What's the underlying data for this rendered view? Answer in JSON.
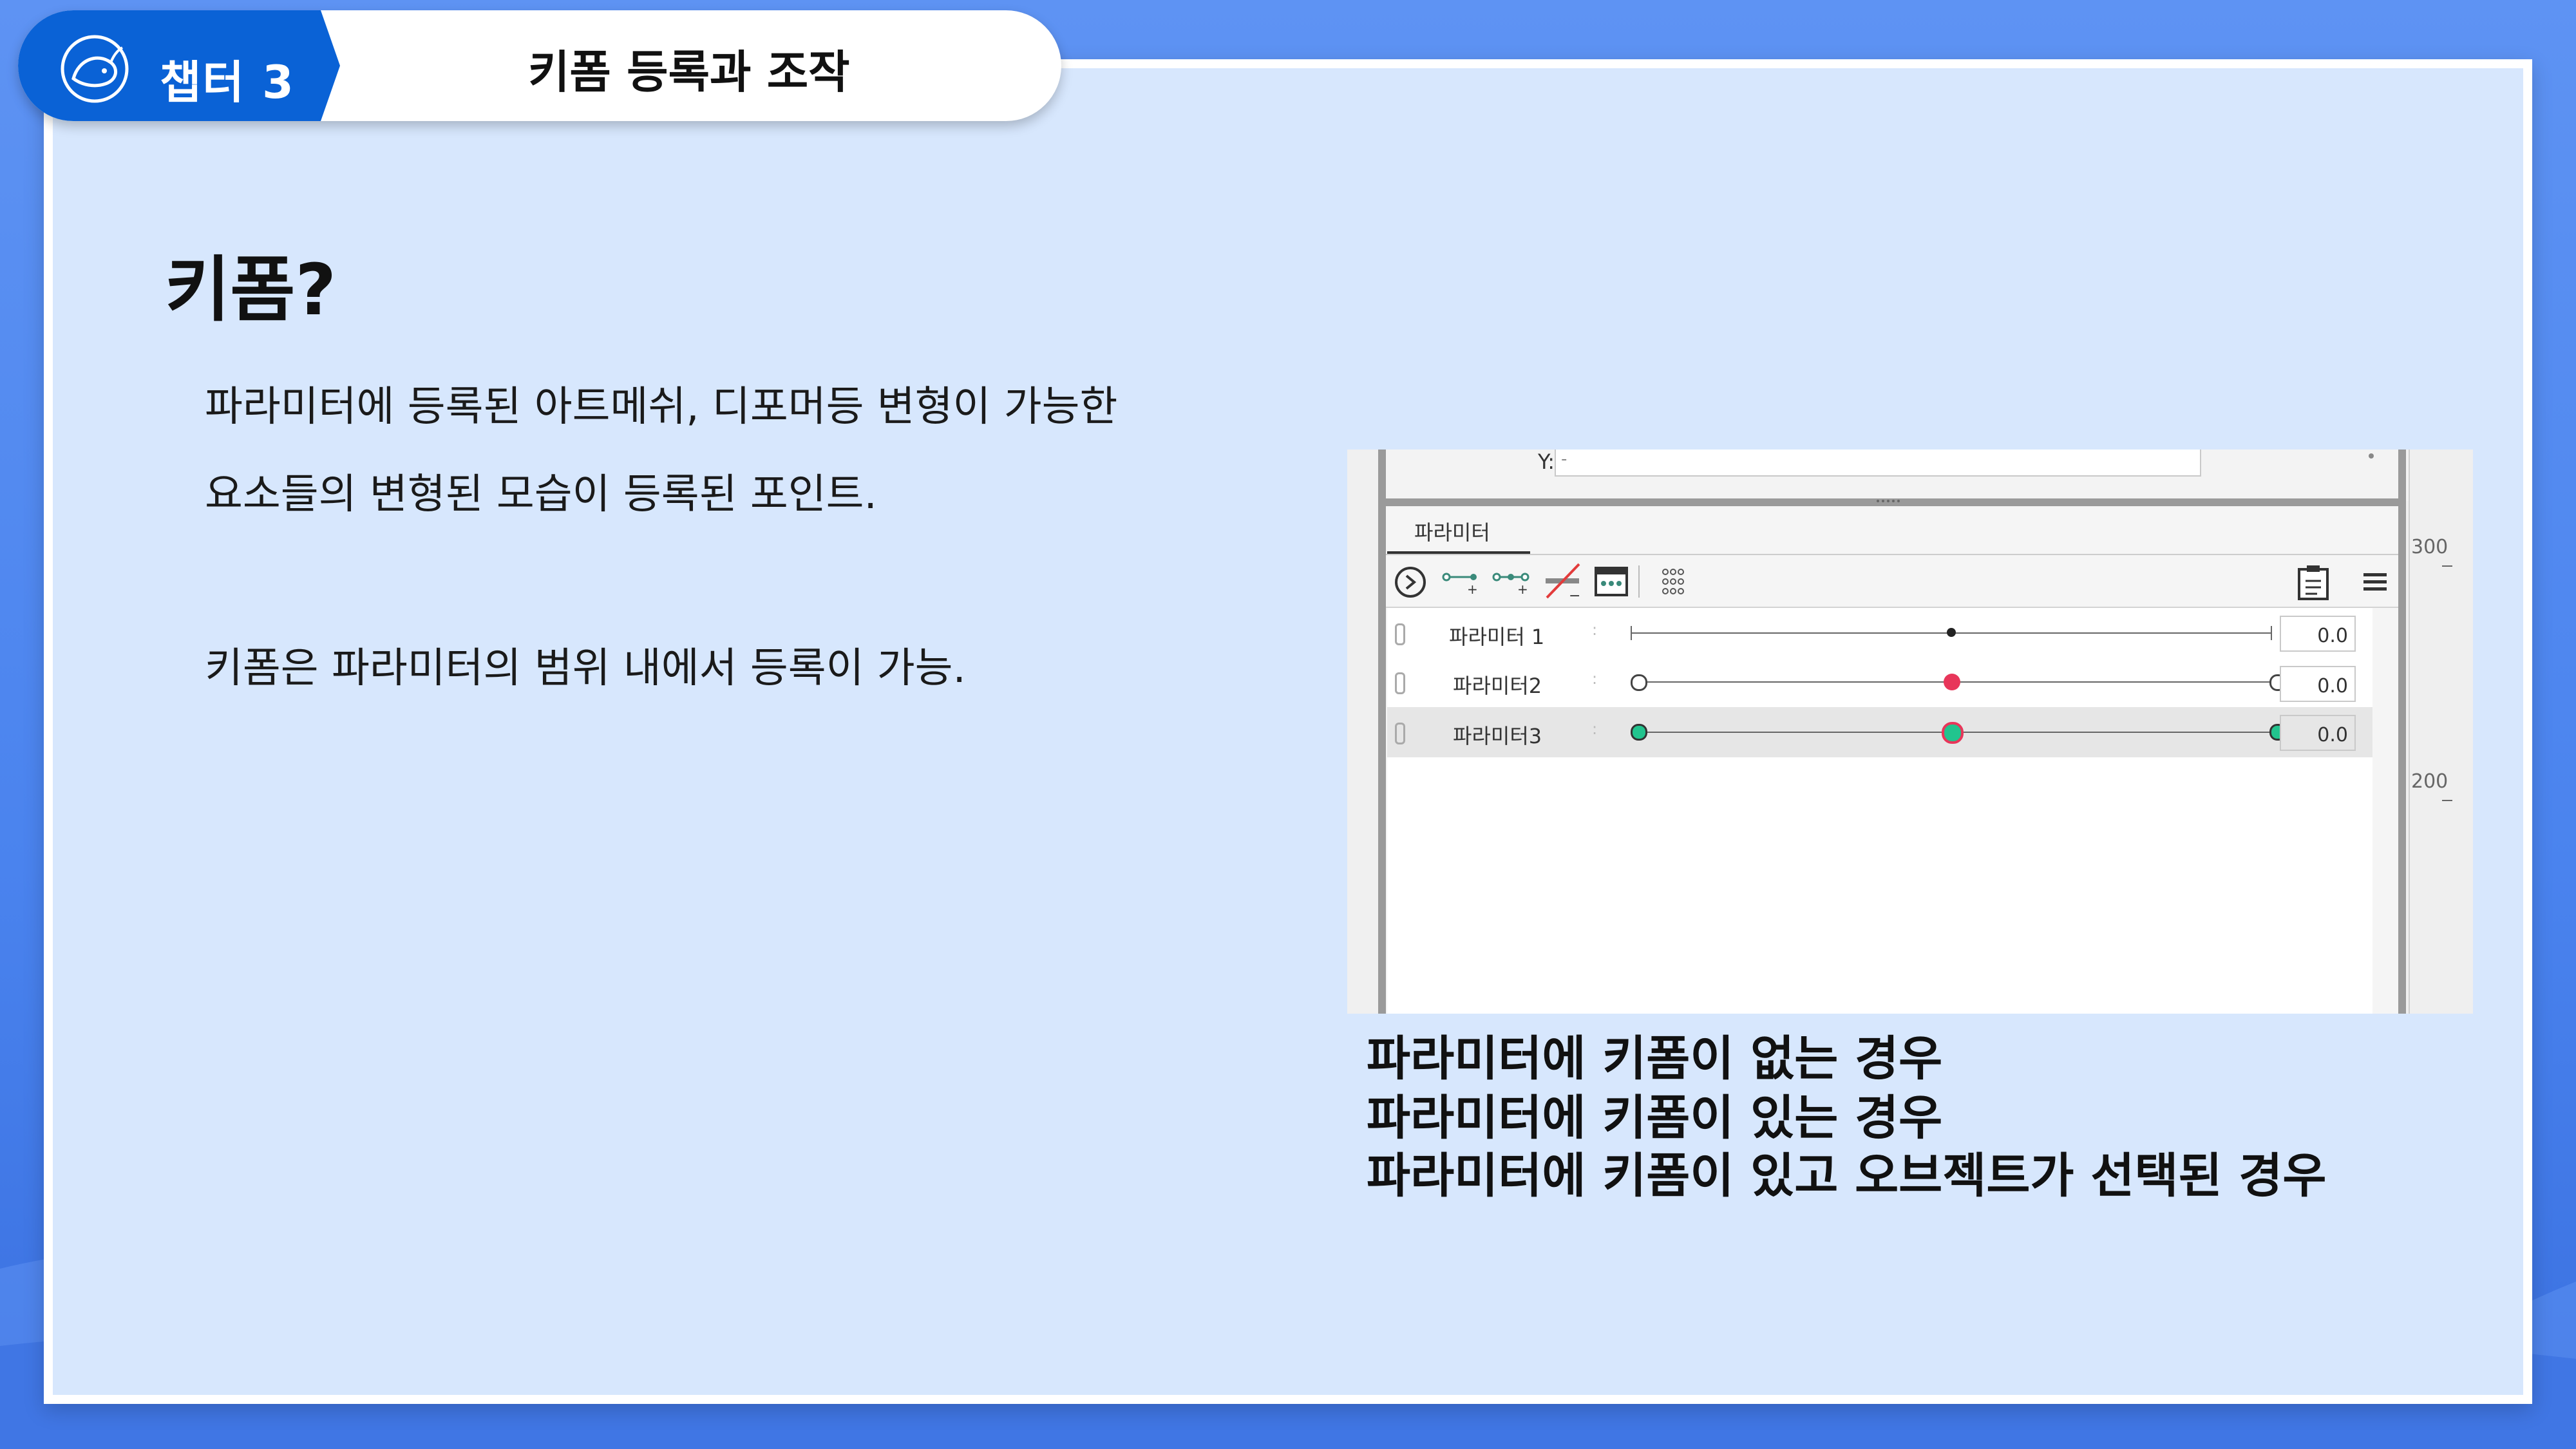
{
  "header": {
    "chapter_label": "챕터 3",
    "topic_title": "키폼 등록과 조작"
  },
  "content": {
    "heading": "키폼?",
    "paragraph_line1": "파라미터에 등록된 아트메쉬, 디포머등 변형이 가능한",
    "paragraph_line2": "요소들의 변형된 모습이 등록된 포인트.",
    "paragraph_line3": "키폼은 파라미터의 범위 내에서 등록이 가능."
  },
  "screenshot": {
    "y_label": "Y:",
    "y_value": "-",
    "panel_tab": "파라미터",
    "ruler_300": "300",
    "ruler_200": "200",
    "parameters": [
      {
        "name": "파라미터 1",
        "value": "0.0",
        "state": "no-keyform"
      },
      {
        "name": "파라미터2",
        "value": "0.0",
        "state": "keyform"
      },
      {
        "name": "파라미터3",
        "value": "0.0",
        "state": "keyform-selected"
      }
    ],
    "colors": {
      "keyform_red": "#e8365a",
      "keyform_green": "#22c48e",
      "selected_row": "#e6e6e6"
    }
  },
  "captions": [
    "파라미터에 키폼이 없는 경우",
    "파라미터에 키폼이 있는 경우",
    "파라미터에 키폼이 있고 오브젝트가 선택된 경우"
  ]
}
